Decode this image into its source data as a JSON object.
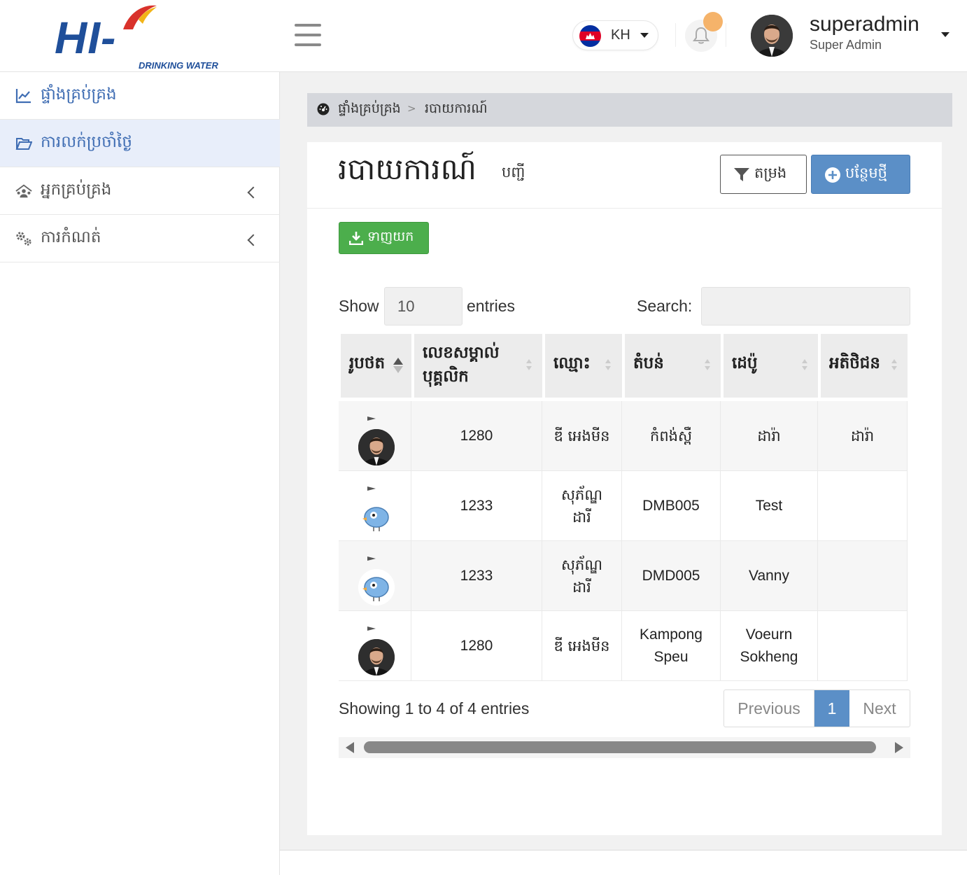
{
  "brand": {
    "logo_text": "HI-TECH",
    "logo_sub": "DRINKING WATER"
  },
  "header": {
    "language_code": "KH",
    "user_name": "superadmin",
    "user_role": "Super Admin"
  },
  "sidebar": {
    "items": [
      {
        "label": "ផ្ទាំងគ្រប់គ្រង",
        "icon": "chart-line-icon"
      },
      {
        "label": "ការលក់ប្រចាំថ្ងៃ",
        "icon": "folder-open-icon"
      },
      {
        "label": "អ្នកគ្រប់គ្រង",
        "icon": "users-icon"
      },
      {
        "label": "ការកំណត់",
        "icon": "cogs-icon"
      }
    ]
  },
  "breadcrumb": {
    "home": "ផ្ទាំងគ្រប់គ្រង",
    "separator": ">",
    "current": "របាយការណ៍"
  },
  "page": {
    "title": "របាយការណ៍",
    "subtitle": "បញ្ជី",
    "filter_label": "តម្រង",
    "add_label": "បន្ថែមថ្មី",
    "download_label": "ទាញយក"
  },
  "table_controls": {
    "show_label": "Show",
    "length_value": "10",
    "entries_label": "entries",
    "search_label": "Search:"
  },
  "table": {
    "columns": [
      "រូបថត",
      "លេខសម្គាល់បុគ្គលិក",
      "ឈ្មោះ",
      "តំបន់",
      "ដេប៉ូ",
      "អតិថិជន"
    ],
    "rows": [
      {
        "photo": "man-photo",
        "staff_id": "1280",
        "name": "ឌី អេងមីន",
        "zone": "កំពង់ស្ពឺ",
        "depot": "ដារ៉ា",
        "customer": "ដារ៉ា"
      },
      {
        "photo": "bird-photo",
        "staff_id": "1233",
        "name": "សុភ័ណ្ឌ ដារី",
        "zone": "DMB005",
        "depot": "Test",
        "customer": ""
      },
      {
        "photo": "bird-photo",
        "staff_id": "1233",
        "name": "សុភ័ណ្ឌ ដារី",
        "zone": "DMD005",
        "depot": "Vanny",
        "customer": ""
      },
      {
        "photo": "man-photo",
        "staff_id": "1280",
        "name": "ឌី អេងមីន",
        "zone": "Kampong Speu",
        "depot": "Voeurn Sokheng",
        "customer": ""
      }
    ]
  },
  "pagination": {
    "info": "Showing 1 to 4 of 4 entries",
    "previous": "Previous",
    "current_page": "1",
    "next": "Next"
  },
  "colors": {
    "primary": "#5b8fc7",
    "success": "#4cae4c",
    "brand": "#1f4f9a",
    "brand_accent": "#d9322b",
    "notification": "#f5b36a"
  }
}
